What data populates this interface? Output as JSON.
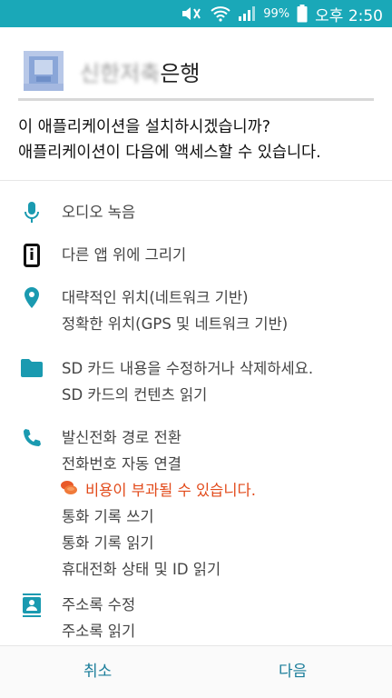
{
  "status_bar": {
    "battery": "99%",
    "time": "오후 2:50",
    "icons": [
      "mute-icon",
      "wifi-icon",
      "signal-icon"
    ]
  },
  "app": {
    "name_obscured": "신한저축",
    "name_visible": "은행",
    "icon": "app-icon"
  },
  "question": {
    "line1": "이 애플리케이션을 설치하시겠습니까?",
    "line2": "애플리케이션이 다음에 액세스할 수 있습니다."
  },
  "permissions": [
    {
      "icon": "microphone-icon",
      "items": [
        "오디오 녹음"
      ]
    },
    {
      "icon": "overlay-icon",
      "items": [
        "다른 앱 위에 그리기"
      ]
    },
    {
      "icon": "location-icon",
      "items": [
        "대략적인 위치(네트워크 기반)",
        "정확한 위치(GPS 및 네트워크 기반)"
      ]
    },
    {
      "icon": "folder-icon",
      "items": [
        "SD 카드 내용을 수정하거나 삭제하세요.",
        "SD 카드의 컨텐츠 읽기"
      ]
    },
    {
      "icon": "phone-icon",
      "items": [
        "발신전화 경로 전환",
        "전화번호 자동 연결"
      ],
      "warning": "비용이 부과될 수 있습니다.",
      "items_after": [
        "통화 기록 쓰기",
        "통화 기록 읽기",
        "휴대전화 상태 및 ID 읽기"
      ]
    },
    {
      "icon": "contacts-icon",
      "items": [
        "주소록 수정",
        "주소록 읽기"
      ]
    }
  ],
  "buttons": {
    "cancel": "취소",
    "next": "다음"
  },
  "colors": {
    "status_bar": "#1aa8b8",
    "icon_teal": "#1a9ab0",
    "warning": "#e24a1a",
    "button_text": "#1a7d9a"
  }
}
